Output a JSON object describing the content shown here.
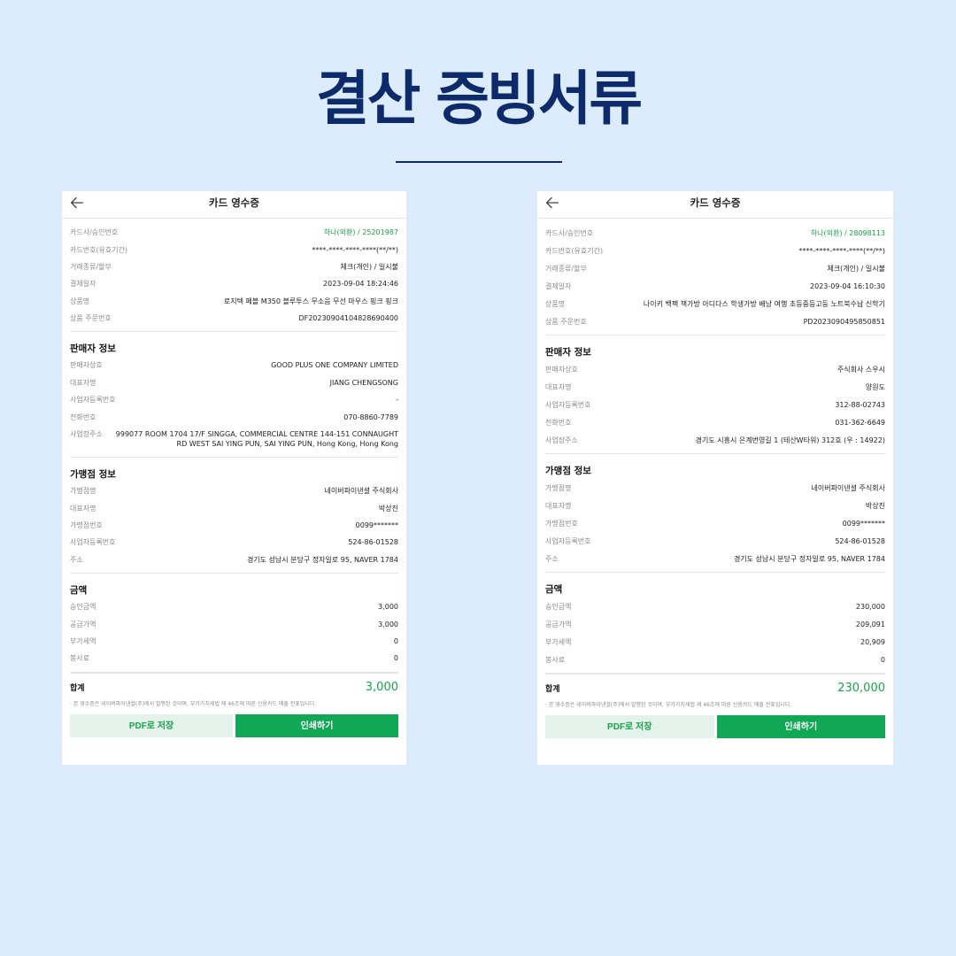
{
  "page": {
    "title": "결산 증빙서류"
  },
  "receipts": [
    {
      "header": "카드 영수증",
      "payment": [
        {
          "label": "카드사/승인번호",
          "value": "하나(외환) / 25201987",
          "highlight": true
        },
        {
          "label": "카드번호(유효기간)",
          "value": "****-****-****-****(**/**)"
        },
        {
          "label": "거래종류/할부",
          "value": "체크(개인) / 일시불"
        },
        {
          "label": "결제일자",
          "value": "2023-09-04 18:24:46"
        },
        {
          "label": "상품명",
          "value": "로지텍 페블 M350 블루투스 무소음 무선 마우스 핑크 핑크"
        },
        {
          "label": "상품 주문번호",
          "value": "DF20230904104828690400"
        }
      ],
      "seller": {
        "title": "판매자 정보",
        "rows": [
          {
            "label": "판매자상호",
            "value": "GOOD PLUS ONE COMPANY LIMITED"
          },
          {
            "label": "대표자명",
            "value": "JIANG CHENGSONG"
          },
          {
            "label": "사업자등록번호",
            "value": "-"
          },
          {
            "label": "전화번호",
            "value": "070-8860-7789"
          },
          {
            "label": "사업장주소",
            "value": "999077 ROOM 1704 17/F SINGGA, COMMERCIAL CENTRE 144-151 CONNAUGHT RD WEST SAI YING PUN, SAI YING PUN, Hong Kong, Hong Kong"
          }
        ]
      },
      "merchant": {
        "title": "가맹점 정보",
        "rows": [
          {
            "label": "가맹점명",
            "value": "네이버파이낸셜 주식회사"
          },
          {
            "label": "대표자명",
            "value": "박상진"
          },
          {
            "label": "가맹점번호",
            "value": "0099*******"
          },
          {
            "label": "사업자등록번호",
            "value": "524-86-01528"
          },
          {
            "label": "주소",
            "value": "경기도 성남시 분당구 정자일로 95, NAVER 1784"
          }
        ]
      },
      "amount": {
        "title": "금액",
        "rows": [
          {
            "label": "승인금액",
            "value": "3,000"
          },
          {
            "label": "공급가액",
            "value": "3,000"
          },
          {
            "label": "부가세액",
            "value": "0"
          },
          {
            "label": "봉사료",
            "value": "0"
          }
        ]
      },
      "total": {
        "label": "합계",
        "value": "3,000"
      },
      "notice": "· 본 영수증은 네이버파이낸셜(주)에서 발행된 것이며, 부가가치세법 제 46조에 따른 신용카드 매출 전표입니다.",
      "buttons": {
        "pdf": "PDF로 저장",
        "print": "인쇄하기"
      }
    },
    {
      "header": "카드 영수증",
      "payment": [
        {
          "label": "카드사/승인번호",
          "value": "하나(외환) / 28098113",
          "highlight": true
        },
        {
          "label": "카드번호(유효기간)",
          "value": "****-****-****-****(**/**)"
        },
        {
          "label": "거래종류/할부",
          "value": "체크(개인) / 일시불"
        },
        {
          "label": "결제일자",
          "value": "2023-09-04 16:10:30"
        },
        {
          "label": "상품명",
          "value": "나이키 백팩 책가방 아디다스 학생가방 배낭 여행 초등중등고등 노트북수납 신학기"
        },
        {
          "label": "상품 주문번호",
          "value": "PD2023090495850851"
        }
      ],
      "seller": {
        "title": "판매자 정보",
        "rows": [
          {
            "label": "판매자상호",
            "value": "주식회사 스우시"
          },
          {
            "label": "대표자명",
            "value": "양원도"
          },
          {
            "label": "사업자등록번호",
            "value": "312-88-02743"
          },
          {
            "label": "전화번호",
            "value": "031-362-6649"
          },
          {
            "label": "사업장주소",
            "value": "경기도 시흥시 은계번영길 1 (테산W타워) 312호 (우 : 14922)"
          }
        ]
      },
      "merchant": {
        "title": "가맹점 정보",
        "rows": [
          {
            "label": "가맹점명",
            "value": "네이버파이낸셜 주식회사"
          },
          {
            "label": "대표자명",
            "value": "박상진"
          },
          {
            "label": "가맹점번호",
            "value": "0099*******"
          },
          {
            "label": "사업자등록번호",
            "value": "524-86-01528"
          },
          {
            "label": "주소",
            "value": "경기도 성남시 분당구 정자일로 95, NAVER 1784"
          }
        ]
      },
      "amount": {
        "title": "금액",
        "rows": [
          {
            "label": "승인금액",
            "value": "230,000"
          },
          {
            "label": "공급가액",
            "value": "209,091"
          },
          {
            "label": "부가세액",
            "value": "20,909"
          },
          {
            "label": "봉사료",
            "value": "0"
          }
        ]
      },
      "total": {
        "label": "합계",
        "value": "230,000"
      },
      "notice": "· 본 영수증은 네이버파이낸셜(주)에서 발행된 것이며, 부가가치세법 제 46조에 따른 신용카드 매출 전표입니다.",
      "buttons": {
        "pdf": "PDF로 저장",
        "print": "인쇄하기"
      }
    }
  ],
  "icons": {
    "back": "arrow-left-icon"
  },
  "colors": {
    "background": "#dcecfc",
    "title": "#0d2b6b",
    "accent_green": "#10a854",
    "pdf_button_bg": "#e4f2ec"
  }
}
